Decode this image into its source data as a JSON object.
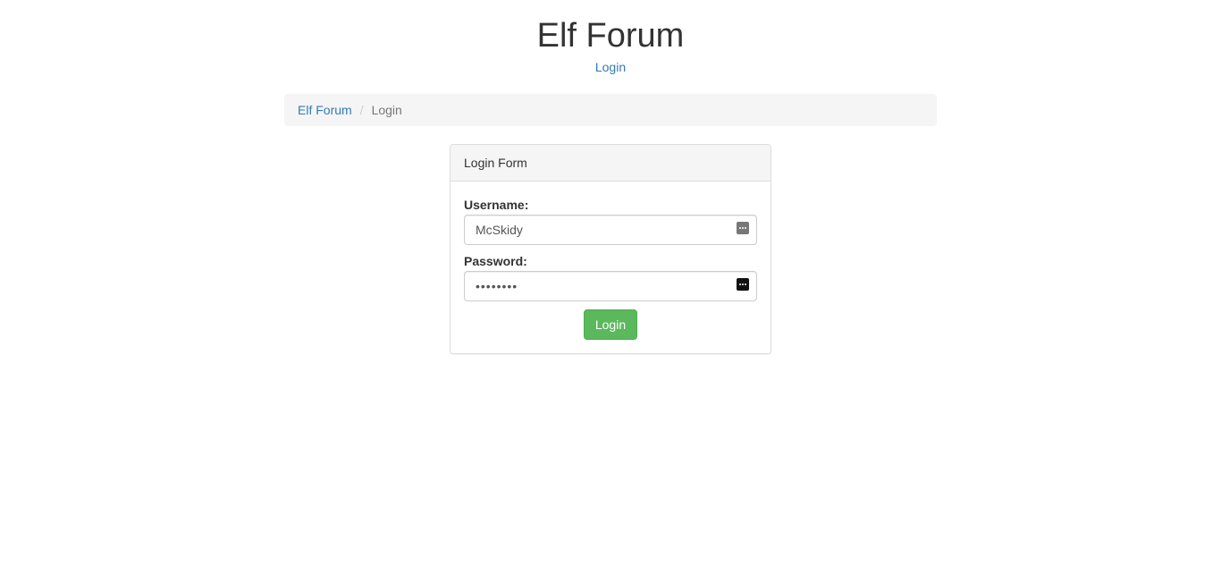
{
  "header": {
    "title": "Elf Forum",
    "nav_link": "Login"
  },
  "breadcrumb": {
    "items": [
      "Elf Forum",
      "Login"
    ],
    "separator": "/"
  },
  "login_form": {
    "heading": "Login Form",
    "username_label": "Username:",
    "username_value": "McSkidy",
    "password_label": "Password:",
    "password_value": "********",
    "submit_label": "Login"
  },
  "colors": {
    "link": "#337ab7",
    "button": "#5cb85c",
    "panel_heading_bg": "#f5f5f5"
  },
  "icons": {
    "username_field": "autofill-dots-icon",
    "password_field": "password-manager-icon"
  }
}
